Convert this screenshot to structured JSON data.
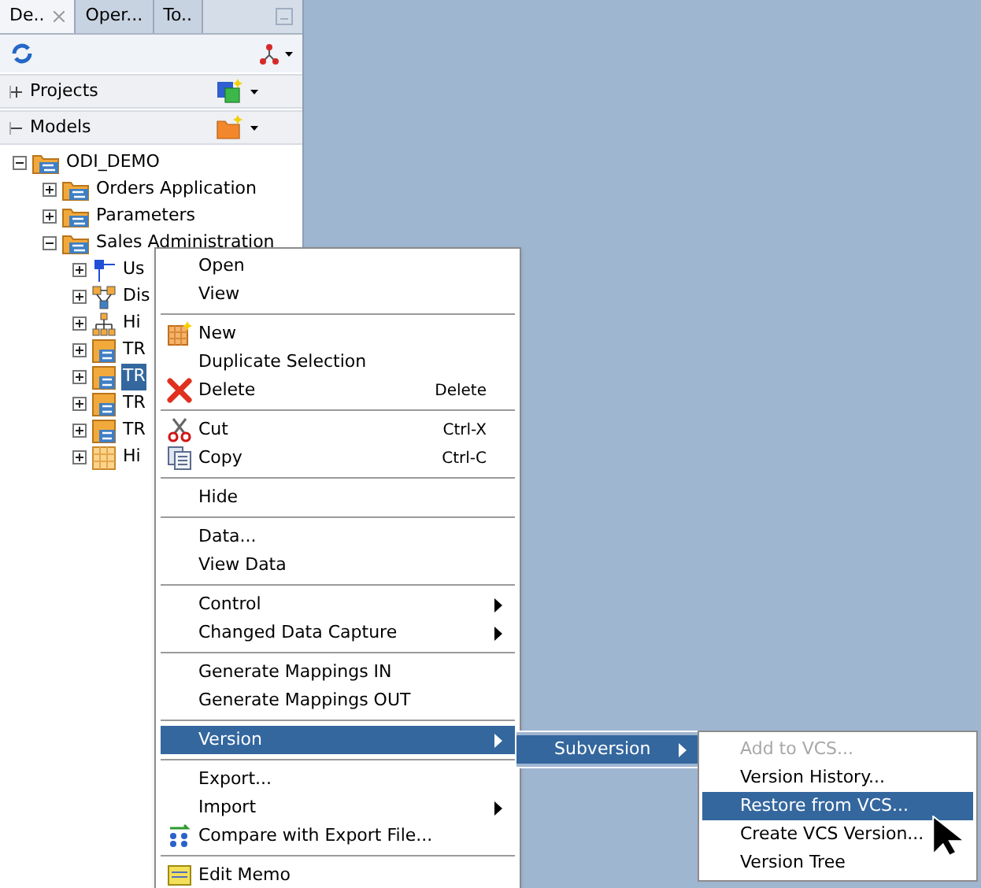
{
  "tabs": [
    {
      "label": "De..",
      "selected": true
    },
    {
      "label": "Oper...",
      "selected": false
    },
    {
      "label": "To..",
      "selected": false
    }
  ],
  "sections": [
    {
      "label": "Projects",
      "expanded": false
    },
    {
      "label": "Models",
      "expanded": true
    }
  ],
  "tree": [
    {
      "label": "ODI_DEMO",
      "expanded": true,
      "selected": false,
      "children": [
        {
          "label": "Orders Application",
          "expanded": false,
          "selected": false
        },
        {
          "label": "Parameters",
          "expanded": false,
          "selected": false
        },
        {
          "label": "Sales Administration",
          "expanded": true,
          "selected": false,
          "children": [
            {
              "label": "Us",
              "expanded": false,
              "selected": false
            },
            {
              "label": "Dis",
              "expanded": false,
              "selected": false
            },
            {
              "label": "Hi",
              "expanded": false,
              "selected": false
            },
            {
              "label": "TR",
              "expanded": false,
              "selected": false
            },
            {
              "label": "TR",
              "expanded": false,
              "selected": true
            },
            {
              "label": "TR",
              "expanded": false,
              "selected": false
            },
            {
              "label": "TR",
              "expanded": false,
              "selected": false
            },
            {
              "label": "Hi",
              "expanded": false,
              "selected": false
            }
          ]
        }
      ]
    }
  ],
  "context_menu": [
    [
      {
        "label": "Open",
        "selected": false
      },
      {
        "label": "View",
        "selected": false
      }
    ],
    [
      {
        "label": "New",
        "selected": false
      },
      {
        "label": "Duplicate Selection",
        "selected": false
      },
      {
        "label": "Delete",
        "shortcut": "Delete",
        "selected": false
      }
    ],
    [
      {
        "label": "Cut",
        "shortcut": "Ctrl-X",
        "selected": false
      },
      {
        "label": "Copy",
        "shortcut": "Ctrl-C",
        "selected": false
      }
    ],
    [
      {
        "label": "Hide",
        "selected": false
      }
    ],
    [
      {
        "label": "Data...",
        "selected": false
      },
      {
        "label": "View Data",
        "selected": false
      }
    ],
    [
      {
        "label": "Control",
        "submenu": true,
        "selected": false
      },
      {
        "label": "Changed Data Capture",
        "submenu": true,
        "selected": false
      }
    ],
    [
      {
        "label": "Generate Mappings IN",
        "selected": false
      },
      {
        "label": "Generate Mappings OUT",
        "selected": false
      }
    ],
    [
      {
        "label": "Version",
        "submenu": true,
        "selected": true
      }
    ],
    [
      {
        "label": "Export...",
        "selected": false
      },
      {
        "label": "Import",
        "submenu": true,
        "selected": false
      },
      {
        "label": "Compare with Export File...",
        "selected": false
      }
    ],
    [
      {
        "label": "Edit Memo",
        "selected": false
      }
    ]
  ],
  "version_submenu": [
    {
      "label": "Subversion",
      "submenu": true,
      "selected": true
    }
  ],
  "subversion_submenu": [
    {
      "label": "Add to VCS...",
      "disabled": true,
      "selected": false
    },
    {
      "label": "Version History...",
      "disabled": false,
      "selected": false
    },
    {
      "label": "Restore from VCS...",
      "disabled": false,
      "selected": true
    },
    {
      "label": "Create VCS Version...",
      "disabled": false,
      "selected": false
    },
    {
      "label": "Version Tree",
      "disabled": false,
      "selected": false
    }
  ]
}
